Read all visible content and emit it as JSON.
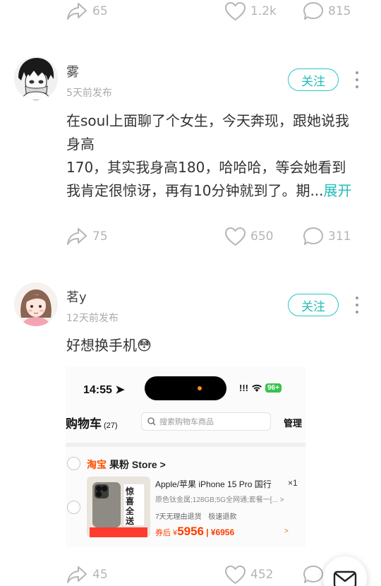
{
  "top_actions": {
    "share_count": "65",
    "like_count": "1.2k",
    "comment_count": "815"
  },
  "posts": [
    {
      "author": "雾",
      "time": "5天前发布",
      "follow_label": "关注",
      "content_lines": [
        "在soul上面聊了个女生，今天奔现，跟她说我",
        "身高",
        "170，其实我身高180，哈哈哈，等会她看到",
        "我肯定很惊讶，再有10分钟就到了。期..."
      ],
      "expand_label": "展开",
      "share_count": "75",
      "like_count": "650",
      "comment_count": "311"
    },
    {
      "author": "茗y",
      "time": "12天前发布",
      "follow_label": "关注",
      "content": "好想换手机",
      "emoji": "😳",
      "share_count": "45",
      "like_count": "452"
    }
  ],
  "screenshot": {
    "status_time": "14:55",
    "signal": "!!!",
    "battery": "96+",
    "cart_title": "购物车",
    "cart_count": "(27)",
    "search_placeholder": "搜索购物车商品",
    "manage_label": "管理",
    "store_brand": "淘宝",
    "store_name": "果粉 Store",
    "store_chevron": ">",
    "product_name": "Apple/苹果 iPhone 15 Pro 国行",
    "quantity": "×1",
    "spec": "原色钛金属;128GB;5G全网通;套餐一[...",
    "spec_chevron": ">",
    "tag_return": "7天无理由退货",
    "tag_refund": "极速退款",
    "price_prefix": "券后 ¥",
    "price": "5956",
    "original_price": "| ¥6956",
    "thumb_text": "惊喜全送",
    "price_arrow": ">"
  }
}
